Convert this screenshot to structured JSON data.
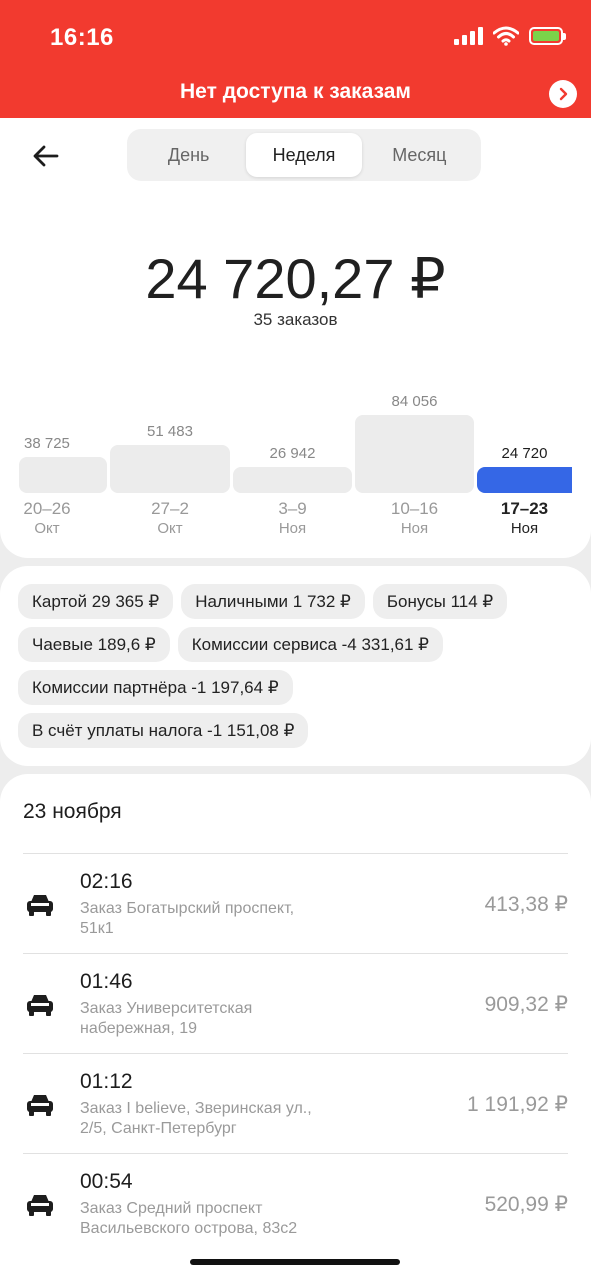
{
  "status_bar": {
    "time": "16:16"
  },
  "banner": {
    "text": "Нет доступа к заказам"
  },
  "period_tabs": [
    "День",
    "Неделя",
    "Месяц"
  ],
  "summary": {
    "total": "24 720,27 ₽",
    "orders": "35 заказов"
  },
  "chart_data": {
    "type": "bar",
    "categories": [
      "20–26 Окт",
      "27–2 Окт",
      "3–9 Ноя",
      "10–16 Ноя",
      "17–23 Ноя"
    ],
    "values": [
      38725,
      51483,
      26942,
      84056,
      24720
    ],
    "value_labels": [
      "38 725",
      "51 483",
      "26 942",
      "84 056",
      "24 720"
    ],
    "week_ranges": [
      "20–26",
      "27–2",
      "3–9",
      "10–16",
      "17–23"
    ],
    "week_months": [
      "Окт",
      "Окт",
      "Ноя",
      "Ноя",
      "Ноя"
    ],
    "highlighted_index": 4,
    "highlight_color": "#3567e6"
  },
  "chips": [
    "Картой 29 365 ₽",
    "Наличными 1 732 ₽",
    "Бонусы 114 ₽",
    "Чаевые 189,6 ₽",
    "Комиссии сервиса -4 331,61 ₽",
    "Комиссии партнёра -1 197,64 ₽",
    "В счёт уплаты налога -1 151,08 ₽"
  ],
  "orders_section": {
    "date": "23 ноября",
    "orders": [
      {
        "time": "02:16",
        "address": "Заказ Богатырский проспект, 51к1",
        "price": "413,38 ₽"
      },
      {
        "time": "01:46",
        "address": "Заказ Университетская набережная, 19",
        "price": "909,32 ₽"
      },
      {
        "time": "01:12",
        "address": "Заказ I believe, Зверинская ул., 2/5, Санкт-Петербург",
        "price": "1 191,92 ₽"
      },
      {
        "time": "00:54",
        "address": "Заказ Средний проспект Васильевского острова, 83с2",
        "price": "520,99 ₽"
      }
    ]
  }
}
